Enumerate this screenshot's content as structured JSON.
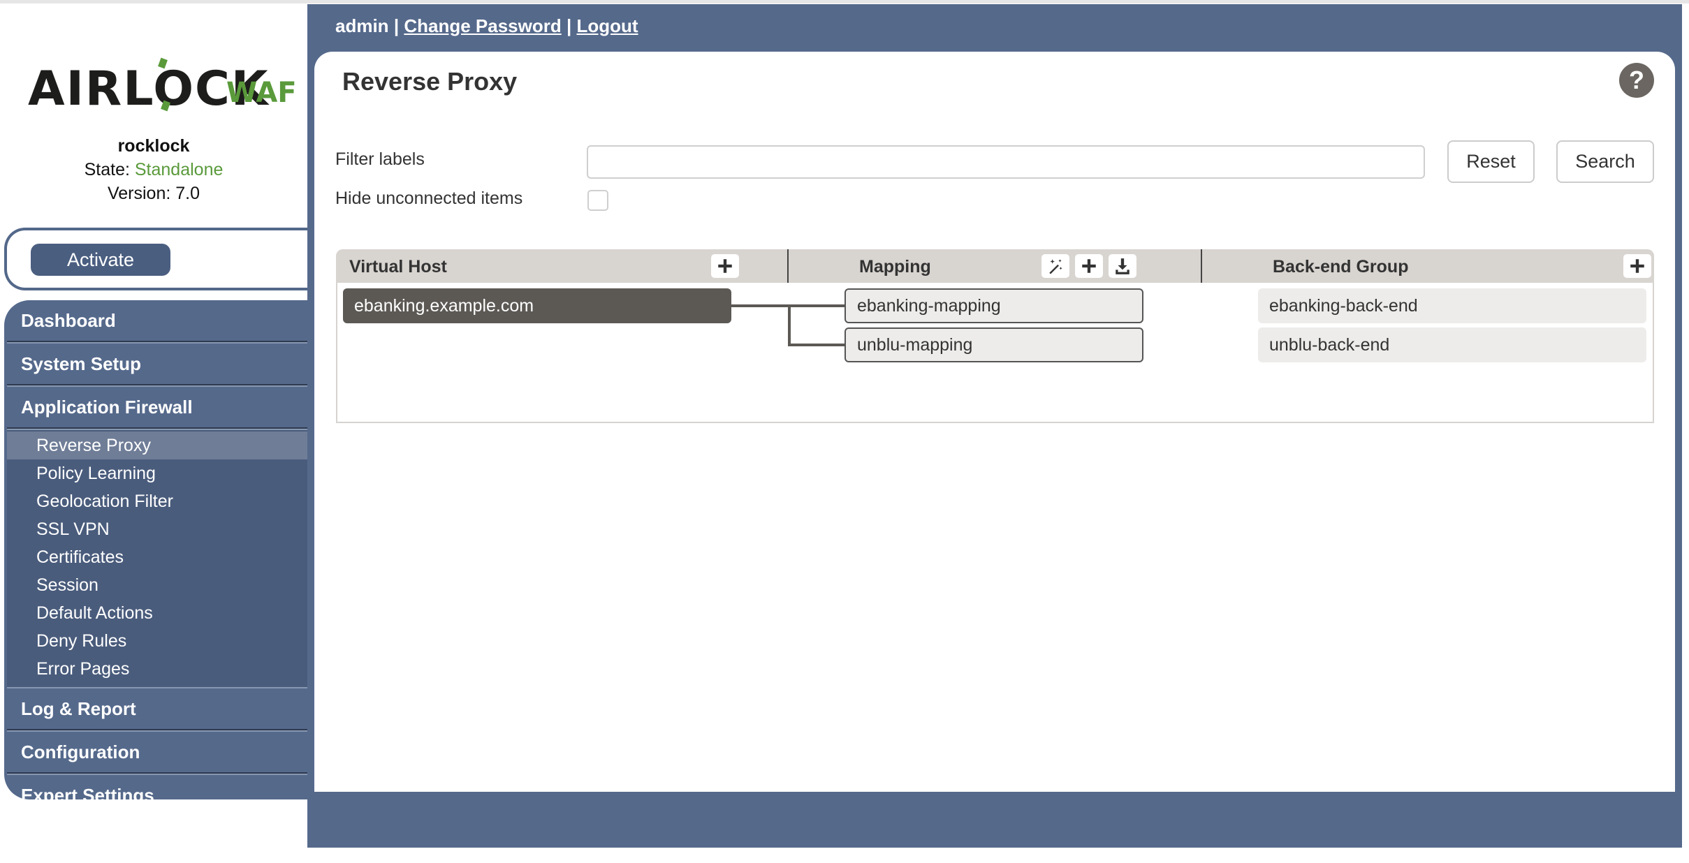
{
  "sidebar": {
    "logo": {
      "main": "AIRLOCK",
      "suffix": "WAF"
    },
    "host_name": "rocklock",
    "state_label": "State:",
    "state_value": "Standalone",
    "version_label": "Version:",
    "version_value": "7.0",
    "activate_label": "Activate",
    "nav": {
      "dashboard": "Dashboard",
      "system_setup": "System Setup",
      "application_firewall": "Application Firewall",
      "sub_items": [
        "Reverse Proxy",
        "Policy Learning",
        "Geolocation Filter",
        "SSL VPN",
        "Certificates",
        "Session",
        "Default Actions",
        "Deny Rules",
        "Error Pages"
      ],
      "active_sub_item": "Reverse Proxy",
      "log_report": "Log & Report",
      "configuration": "Configuration",
      "expert_settings": "Expert Settings"
    }
  },
  "header": {
    "user": "admin",
    "separator": "|",
    "change_password": "Change Password",
    "logout": "Logout"
  },
  "page": {
    "title": "Reverse Proxy",
    "help_icon": "?",
    "filter": {
      "label": "Filter labels",
      "value": "",
      "placeholder": "",
      "reset_label": "Reset",
      "search_label": "Search",
      "hide_unconnected_label": "Hide unconnected items",
      "hide_unconnected_checked": false
    },
    "table": {
      "columns": {
        "virtual_host": "Virtual Host",
        "mapping": "Mapping",
        "backend_group": "Back-end Group"
      },
      "header_icons": {
        "virtual_host": [
          "plus-icon"
        ],
        "mapping": [
          "magic-wand-icon",
          "plus-icon",
          "download-icon"
        ],
        "backend_group": [
          "plus-icon"
        ]
      },
      "virtual_hosts": [
        "ebanking.example.com"
      ],
      "mappings": [
        "ebanking-mapping",
        "unblu-mapping"
      ],
      "backend_groups": [
        "ebanking-back-end",
        "unblu-back-end"
      ],
      "connections": [
        {
          "virtual_host": "ebanking.example.com",
          "mapping": "ebanking-mapping"
        },
        {
          "virtual_host": "ebanking.example.com",
          "mapping": "unblu-mapping"
        }
      ]
    }
  },
  "colors": {
    "brand_blue": "#55698b",
    "brand_green": "#5a9a3b",
    "active_nav": "#6f7d97",
    "vhost_bg": "#5c5955",
    "header_bg": "#d8d4d0"
  }
}
